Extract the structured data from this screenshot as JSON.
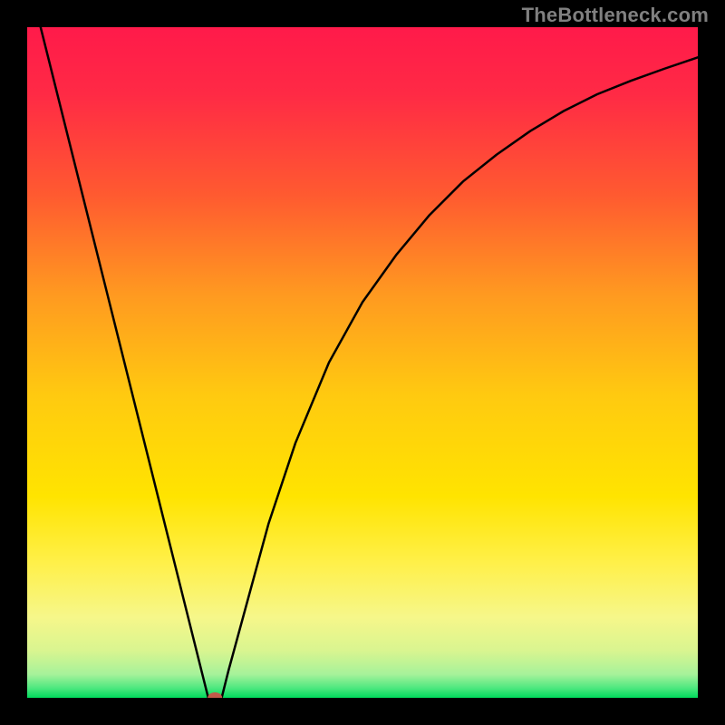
{
  "watermark": "TheBottleneck.com",
  "chart_data": {
    "type": "line",
    "title": "",
    "xlabel": "",
    "ylabel": "",
    "xlim": [
      0,
      100
    ],
    "ylim": [
      0,
      100
    ],
    "series": [
      {
        "name": "bottleneck-curve",
        "x": [
          0,
          3,
          6,
          9,
          12,
          15,
          18,
          21,
          24,
          26,
          27,
          28,
          29,
          30,
          33,
          36,
          40,
          45,
          50,
          55,
          60,
          65,
          70,
          75,
          80,
          85,
          90,
          95,
          100
        ],
        "y": [
          108,
          96,
          84,
          72,
          60,
          48,
          36,
          24,
          12,
          4,
          0,
          0,
          0,
          4,
          15,
          26,
          38,
          50,
          59,
          66,
          72,
          77,
          81,
          84.5,
          87.5,
          90,
          92,
          93.8,
          95.5
        ]
      }
    ],
    "marker": {
      "x": 28,
      "y": 0,
      "color": "#c25a4a"
    },
    "gradient_colors": {
      "top": "#ff1a4a",
      "mid_upper": "#ff7a2a",
      "mid": "#ffd400",
      "mid_lower": "#f7f57a",
      "band": "#d8f58a",
      "bottom": "#00e060"
    },
    "grid": false,
    "legend": false
  }
}
